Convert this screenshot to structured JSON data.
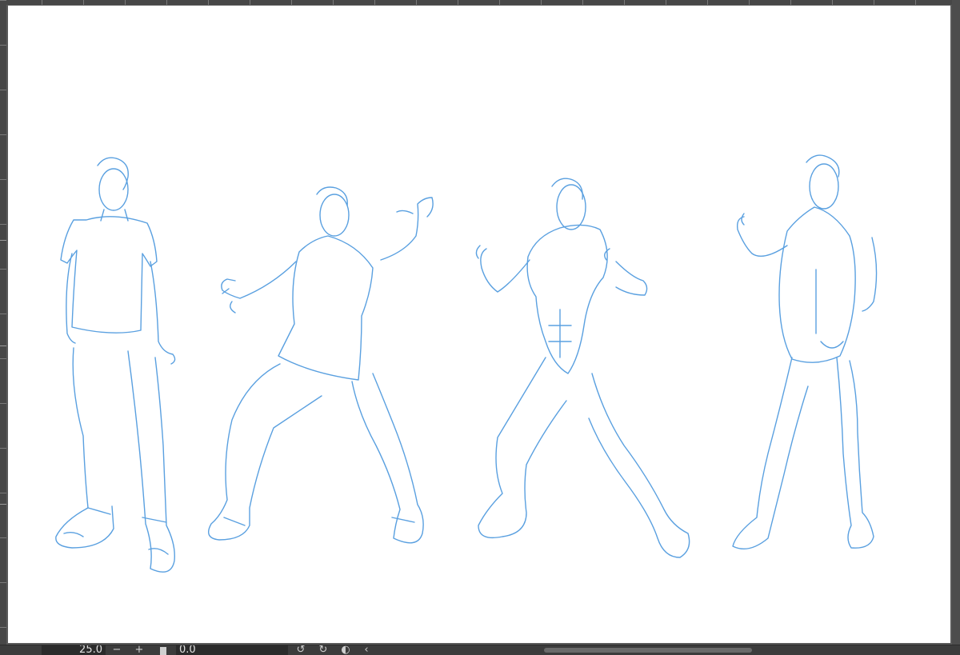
{
  "statusbar": {
    "zoom_value": "25.0",
    "zoom_out_label": "−",
    "zoom_in_label": "+",
    "rotation_value": "0.0",
    "icons": [
      "zoom-slider-icon",
      "rotate-left-icon",
      "rotate-right-icon",
      "reset-rotation-icon",
      "chevron-left-icon"
    ]
  },
  "canvas": {
    "line_color": "#5aa0e0",
    "background": "#ffffff",
    "figures": [
      "figure-clothed-standing",
      "figure-clothed-fighting",
      "figure-nude-front",
      "figure-nude-back"
    ]
  },
  "colors": {
    "ui_dark": "#3c3c3c",
    "ui_mid": "#5a5a5a",
    "field_bg": "#2b2b2b"
  }
}
